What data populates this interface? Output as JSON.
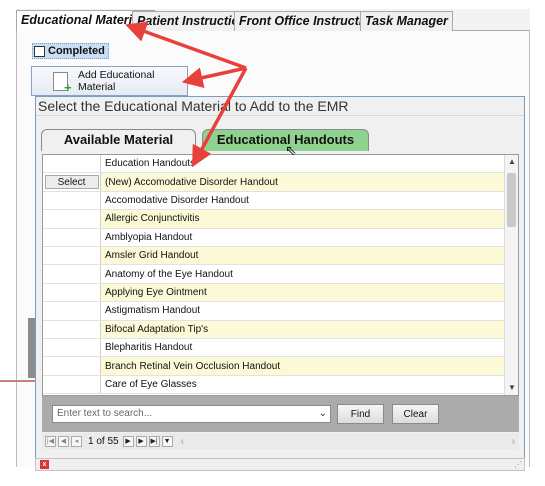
{
  "top_tabs": [
    {
      "label": "Educational Materials"
    },
    {
      "label": "Patient Instructions"
    },
    {
      "label": "Front Office Instructions"
    },
    {
      "label": "Task Manager"
    }
  ],
  "completed_label": "Completed",
  "add_button_label": "Add Educational Material",
  "dialog": {
    "title": "Select the Educational Material to Add to the EMR",
    "tabs": {
      "available": "Available Material",
      "handouts": "Educational Handouts"
    },
    "grid": {
      "header": "Education Handouts",
      "select_label": "Select",
      "rows": [
        "(New) Accomodative Disorder Handout",
        "Accomodative Disorder Handout",
        "Allergic Conjunctivitis",
        "Amblyopia Handout",
        "Amsler Grid Handout",
        "Anatomy of the Eye Handout",
        "Applying Eye Ointment",
        "Astigmatism Handout",
        "Bifocal Adaptation Tip's",
        "Blepharitis Handout",
        "Branch Retinal Vein Occlusion  Handout",
        "Care of Eye Glasses"
      ]
    },
    "search": {
      "placeholder": "Enter text to search...",
      "find_label": "Find",
      "clear_label": "Clear"
    },
    "pager": {
      "text": "1 of 55"
    }
  },
  "colors": {
    "arrow": "#e8413b",
    "tab_active_green": "#8fd28f",
    "row_yellow": "#fbf9d6"
  }
}
